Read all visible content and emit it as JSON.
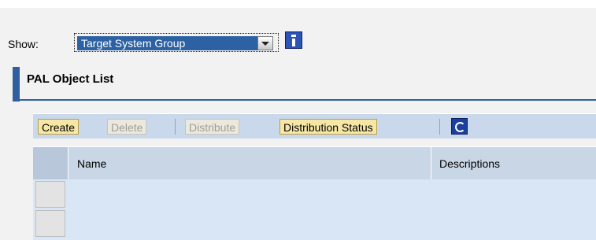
{
  "show": {
    "label": "Show:",
    "selected": "Target System Group"
  },
  "tray": {
    "title": "PAL Object List"
  },
  "toolbar": {
    "buttons": [
      {
        "label": "Create",
        "enabled": true
      },
      {
        "label": "Delete",
        "enabled": false
      },
      {
        "label": "Distribute",
        "enabled": false
      },
      {
        "label": "Distribution Status",
        "enabled": true
      }
    ]
  },
  "table": {
    "columns": [
      "Name",
      "Descriptions"
    ],
    "rows": []
  },
  "icons": {
    "info": "info-icon",
    "refresh": "refresh-icon",
    "dropdown": "chevron-down-icon"
  },
  "colors": {
    "accent": "#2f5f9e",
    "button": "#f7e7a5",
    "toolbar": "#c9d8ea",
    "table_body": "#d9e6f5"
  }
}
